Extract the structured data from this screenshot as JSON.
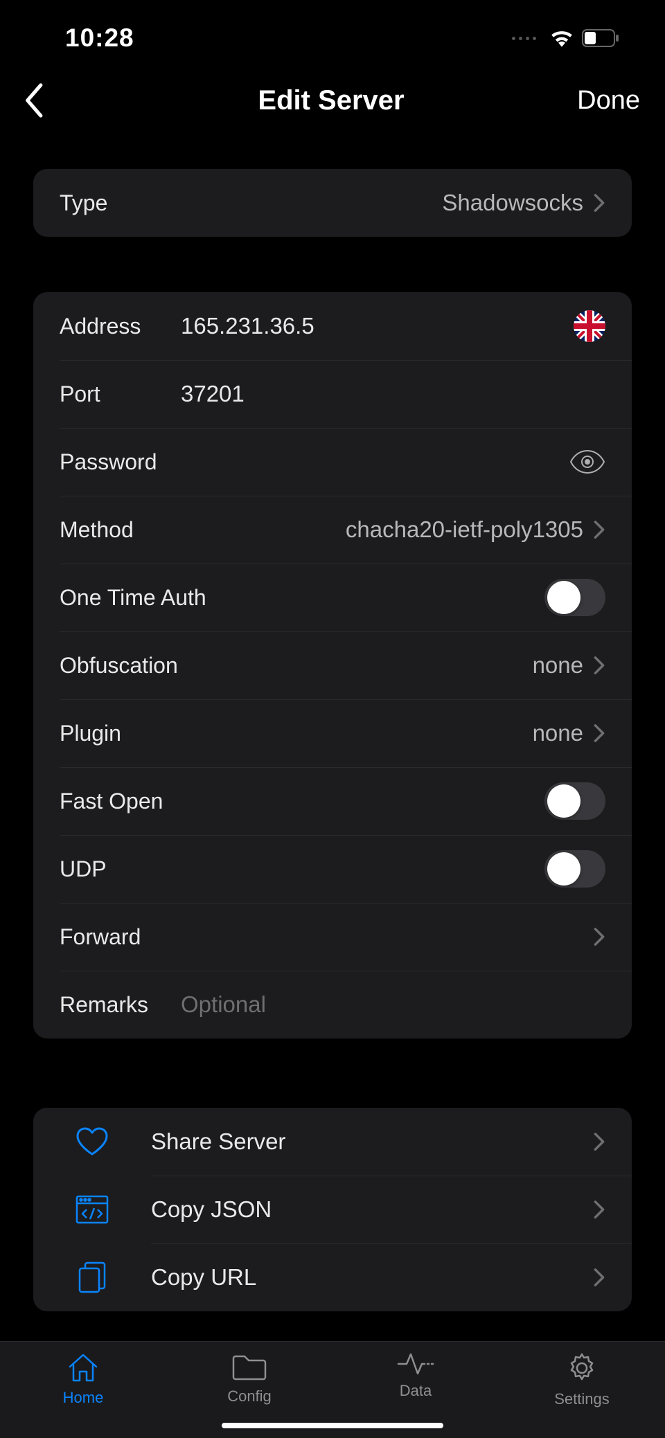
{
  "status": {
    "time": "10:28"
  },
  "nav": {
    "title": "Edit Server",
    "done": "Done"
  },
  "type_row": {
    "label": "Type",
    "value": "Shadowsocks"
  },
  "fields": {
    "address_label": "Address",
    "address_value": "165.231.36.5",
    "port_label": "Port",
    "port_value": "37201",
    "password_label": "Password",
    "password_value": "",
    "method_label": "Method",
    "method_value": "chacha20-ietf-poly1305",
    "ota_label": "One Time Auth",
    "obfs_label": "Obfuscation",
    "obfs_value": "none",
    "plugin_label": "Plugin",
    "plugin_value": "none",
    "fastopen_label": "Fast Open",
    "udp_label": "UDP",
    "forward_label": "Forward",
    "remarks_label": "Remarks",
    "remarks_placeholder": "Optional"
  },
  "actions": {
    "share": "Share Server",
    "copy_json": "Copy JSON",
    "copy_url": "Copy URL"
  },
  "tabs": {
    "home": "Home",
    "config": "Config",
    "data": "Data",
    "settings": "Settings"
  }
}
